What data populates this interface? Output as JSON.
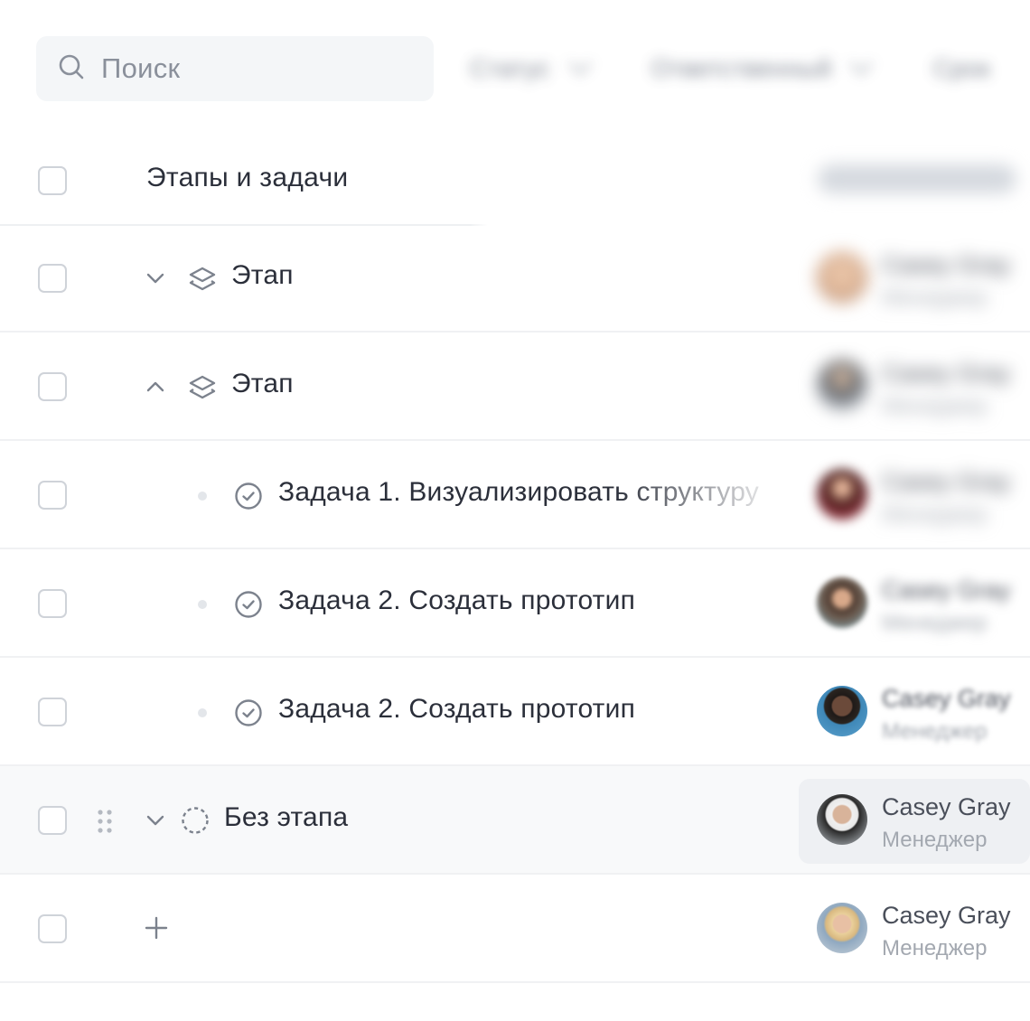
{
  "search": {
    "placeholder": "Поиск",
    "icon": "search-icon"
  },
  "filters": [
    {
      "label": "Статус"
    },
    {
      "label": "Ответственный"
    },
    {
      "label": "Срок"
    }
  ],
  "table": {
    "header": {
      "title": "Этапы и задачи",
      "column": "Ответственный"
    },
    "rows": [
      {
        "type": "stage",
        "label": "Этап",
        "expanded": false,
        "assignee": {
          "name": "Casey Gray",
          "role": "Менеджер"
        }
      },
      {
        "type": "stage",
        "label": "Этап",
        "expanded": true,
        "assignee": {
          "name": "Casey Gray",
          "role": "Менеджер"
        }
      },
      {
        "type": "task",
        "label": "Задача 1. Визуализировать структуру",
        "assignee": {
          "name": "Casey Gray",
          "role": "Менеджер"
        }
      },
      {
        "type": "task",
        "label": "Задача 2. Создать прототип",
        "assignee": {
          "name": "Casey Gray",
          "role": "Менеджер"
        }
      },
      {
        "type": "task",
        "label": "Задача 2. Создать прототип",
        "assignee": {
          "name": "Casey Gray",
          "role": "Менеджер"
        }
      },
      {
        "type": "no-stage",
        "label": "Без этапа",
        "expanded": true,
        "highlighted": true,
        "assignee": {
          "name": "Casey Gray",
          "role": "Менеджер"
        }
      },
      {
        "type": "add",
        "label": "",
        "assignee": {
          "name": "Casey Gray",
          "role": "Менеджер"
        }
      }
    ]
  },
  "colors": {
    "accent_bg": "#f4f6f8",
    "text": "#2b2f3a",
    "muted": "#a3a8b0",
    "icon": "#8a909b",
    "border": "#cfd3d9"
  }
}
